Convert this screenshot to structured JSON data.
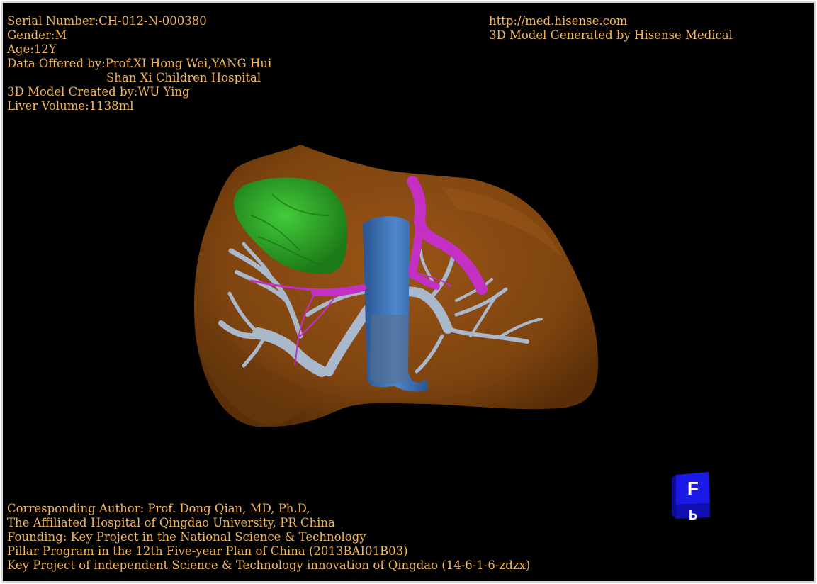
{
  "info": {
    "serial": "Serial Number:CH-012-N-000380",
    "gender": "Gender:M",
    "age": "Age:12Y",
    "data_offered": "Data Offered by:Prof.XI Hong Wei,YANG Hui",
    "hospital": "Shan Xi Children Hospital",
    "model_created": "3D Model Created by:WU Ying",
    "liver_volume": "Liver Volume:1138ml"
  },
  "site": {
    "url": "http://med.hisense.com",
    "generated_by": "3D Model Generated by Hisense Medical"
  },
  "credits": {
    "author": "Corresponding Author: Prof. Dong Qian, MD, Ph.D,",
    "affiliation": "The Affiliated Hospital of Qingdao University, PR China",
    "founding": "Founding: Key Project in the National Science & Technology",
    "program": "Pillar Program in the 12th Five-year Plan of China (2013BAI01B03)",
    "key_project": "Key Project of independent Science & Technology innovation of Qingdao (14-6-1-6-zdzx)"
  },
  "orientation_cube": {
    "front": "F",
    "bottom": "P"
  },
  "colors": {
    "liver": "#8a4c12",
    "tumor": "#2fae2a",
    "vena_cava": "#3e74b8",
    "hepatic_vein": "#c42fc4",
    "portal_vein": "#aab8cc",
    "text": "#f0b65a",
    "cube": "#1a1ae6"
  }
}
